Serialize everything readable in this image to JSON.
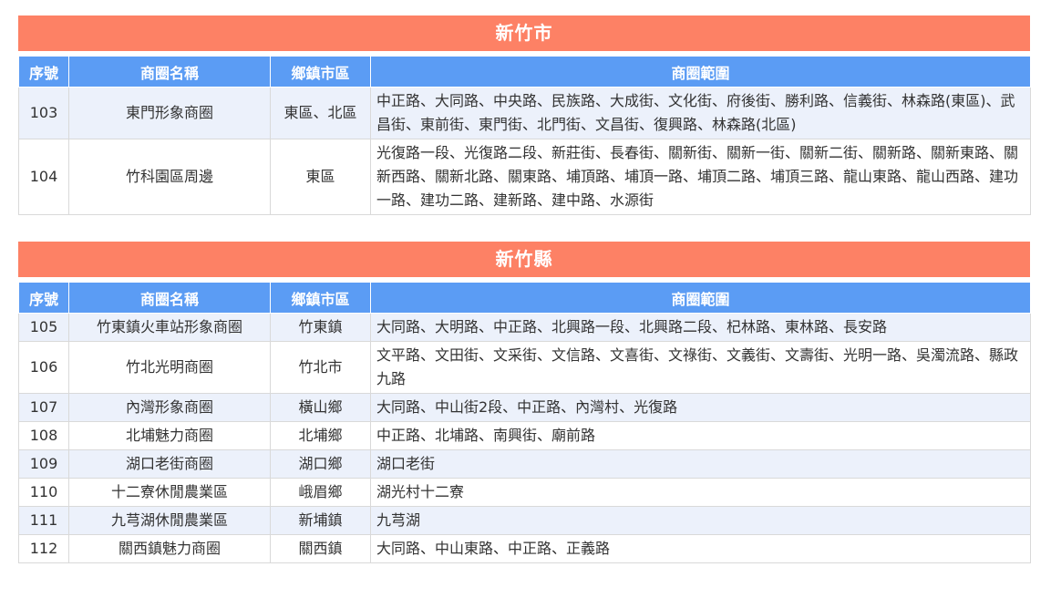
{
  "colors": {
    "region_header_bg": "#fd8165",
    "table_header_bg": "#5b9cf4",
    "row_alt_bg": "#ecf1fb"
  },
  "columns": {
    "no": "序號",
    "name": "商圈名稱",
    "town": "鄉鎮市區",
    "range": "商圈範圍"
  },
  "sections": [
    {
      "region": "新竹市",
      "rows": [
        {
          "no": "103",
          "name": "東門形象商圈",
          "town": "東區、北區",
          "range": "中正路、大同路、中央路、民族路、大成街、文化街、府後街、勝利路、信義街、林森路(東區)、武昌街、東前街、東門街、北門街、文昌街、復興路、林森路(北區)"
        },
        {
          "no": "104",
          "name": "竹科園區周邊",
          "town": "東區",
          "range": "光復路一段、光復路二段、新莊街、長春街、關新街、關新一街、關新二街、關新路、關新東路、關新西路、關新北路、關東路、埔頂路、埔頂一路、埔頂二路、埔頂三路、龍山東路、龍山西路、建功一路、建功二路、建新路、建中路、水源街"
        }
      ]
    },
    {
      "region": "新竹縣",
      "rows": [
        {
          "no": "105",
          "name": "竹東鎮火車站形象商圈",
          "town": "竹東鎮",
          "range": "大同路、大明路、中正路、北興路一段、北興路二段、杞林路、東林路、長安路"
        },
        {
          "no": "106",
          "name": "竹北光明商圈",
          "town": "竹北市",
          "range": "文平路、文田街、文采街、文信路、文喜街、文祿街、文義街、文壽街、光明一路、吳濁流路、縣政九路"
        },
        {
          "no": "107",
          "name": "內灣形象商圈",
          "town": "橫山鄉",
          "range": "大同路、中山街2段、中正路、內灣村、光復路"
        },
        {
          "no": "108",
          "name": "北埔魅力商圈",
          "town": "北埔鄉",
          "range": "中正路、北埔路、南興街、廟前路"
        },
        {
          "no": "109",
          "name": "湖口老街商圈",
          "town": "湖口鄉",
          "range": "湖口老街"
        },
        {
          "no": "110",
          "name": "十二寮休閒農業區",
          "town": "峨眉鄉",
          "range": "湖光村十二寮"
        },
        {
          "no": "111",
          "name": "九芎湖休閒農業區",
          "town": "新埔鎮",
          "range": "九芎湖"
        },
        {
          "no": "112",
          "name": "關西鎮魅力商圈",
          "town": "關西鎮",
          "range": "大同路、中山東路、中正路、正義路"
        }
      ]
    }
  ]
}
